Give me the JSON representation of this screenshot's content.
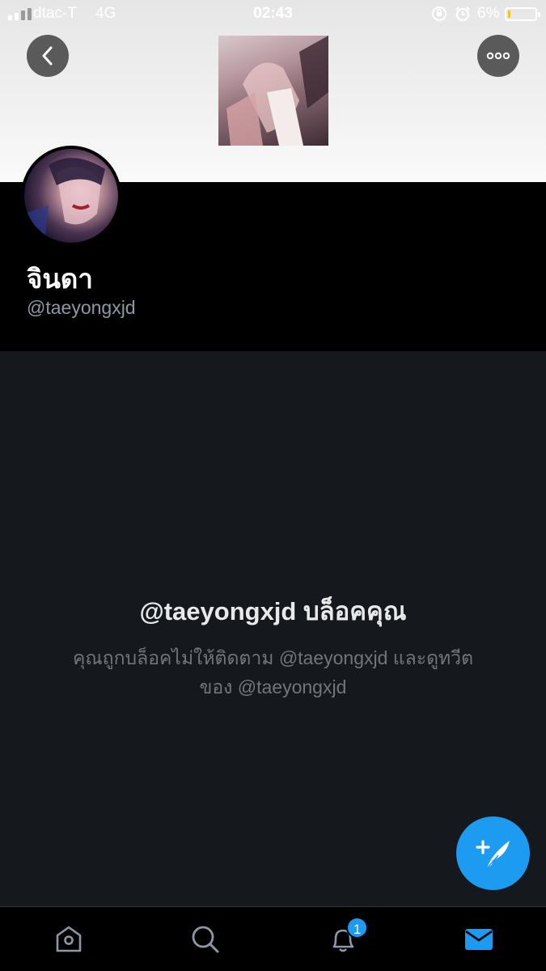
{
  "status_bar": {
    "carrier": "dtac-T",
    "network": "4G",
    "time": "02:43",
    "battery_percent": "6%",
    "battery_level": 0.06,
    "battery_color": "#f5c518"
  },
  "header": {
    "back_icon": "chevron-left-icon",
    "more_icon": "ellipsis-icon"
  },
  "profile": {
    "display_name": "จินดา",
    "handle": "@taeyongxjd"
  },
  "blocked": {
    "title": "@taeyongxjd บล็อคคุณ",
    "description": "คุณถูกบล็อคไม่ให้ติดตาม @taeyongxjd และดูทวีตของ @taeyongxjd"
  },
  "fab": {
    "icon": "compose-tweet-icon"
  },
  "tab_bar": {
    "items": [
      {
        "name": "home",
        "icon": "home-icon",
        "active": false
      },
      {
        "name": "search",
        "icon": "search-icon",
        "active": false
      },
      {
        "name": "notifications",
        "icon": "bell-icon",
        "active": false,
        "badge": "1"
      },
      {
        "name": "messages",
        "icon": "mail-icon",
        "active": true
      }
    ]
  },
  "colors": {
    "accent": "#1d9bf0",
    "background": "#15181c",
    "header_background": "#000000",
    "secondary_text": "#71767b"
  }
}
